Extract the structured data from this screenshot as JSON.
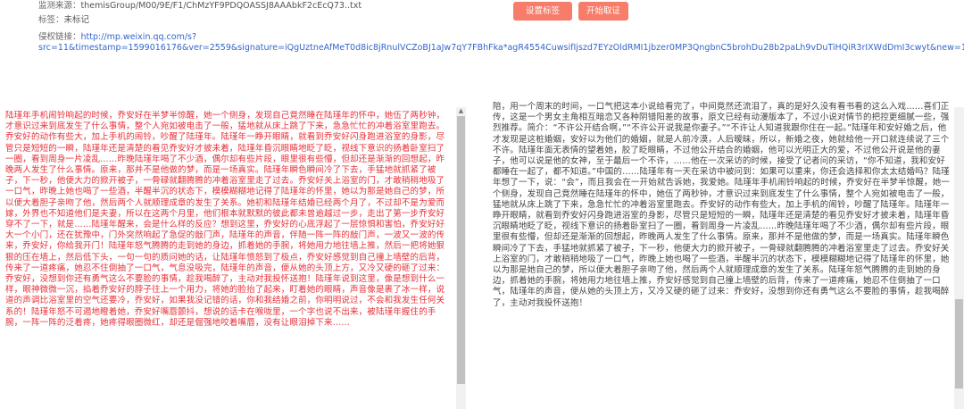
{
  "meta": {
    "path_label": "监测来源：",
    "path_value": "themisGroup/M00/9E/F1/ChMzYF9PDQOASSJ8AAAbkF2cEcQ73..txt",
    "tag_label": "标签：",
    "tag_value": "未标记",
    "link_label": "侵权链接：",
    "link_value": "http://mp.weixin.qq.com/s?src=11&timestamp=1599016176&ver=2559&signature=iQgUztneAfMeT0d8ic8jRnulVCZoBJ1aJw7qY7FBhFka*agR4554CuwsifIjszd7EYzOldRMI1jbzer0MP3QngbnC5brohDu28b2paLh9vDuTiHQiR3rIXWdDmI3cwyt&new=1"
  },
  "buttons": {
    "tag": "设置标签",
    "start": "开始取证"
  },
  "left_text": "陆瑾年手机闹铃响起的时候，乔安好在半梦半惊醒，她一个侧身，发现自己竟然睡在陆瑾年的怀中，她伍了两秒钟，才意识过来到底发生了什么事情，整个人宛如被电击了一般，猛地就从床上跳了下来，急急忙忙的冲着浴室里跑去。乔安好的动作有些大，加上手机的闹铃，吵醒了陆瑾年。陆瑾年一睁开眼睛，就看到乔安好闪身跑进浴室的身影，尽管只是短短的一瞬，陆瑾年还是清楚的看见乔安好才披未着，陆瑾年昏沉眼睛地眨了眨，视线下意识的扬着卧室扫了一圈，看到周身一片凌乱……昨晚陆瑾年喝了不少酒，偶尔却有些片段，眼里很有些懵，但却还是渐渐的回想起，昨晚两人发生了什么事情。原来，那并不是他做的梦，而是一场真实。陆瑾年瞬色瞬间冷了下去，手猛地就抓紧了被子，下一秒，他便大力的掀开被子，一骨碌就翻腾腾的冲着浴室里走了过去。乔安好关上浴室的门，才敢稍稍地吸了一口气，昨晚上她也喝了一些酒，半醒半沉的状态下，模模糊糊地记得了陆瑾年的怀里，她以为那是她自己的梦，所以便大着胆子亲吻了他，然后两个人就顺理成章的发生了关系。她初和陆瑾年结婚已经两个月了，不过却不是为爱而嫁，外界也不知道他们是夫妻，所以在这两个月里，他们根本就默默的彼此都未曾逾越过一步，走出了第一步乔安好穿不了一下，就是……陆瑾年醒来，会是什么样的反应？想到这里，乔安好的心底浮起了一层惊惧和害怕，乔安好好大一个小门，还在犹豫中，门外突然响起了急促的敲门声，陆瑾年的声音，伴随一阵一阵的敲门声，一波又一波的传来，乔安好，你给我开门！陆瑾年怒气腾腾的走到她的身边，抓着她的手腕，将她用力地往墙上推，然后一把将她狠狠的压在墙上，然后低下头，一句一句的质问她的话，让陆瑾年愤怒到了极点，乔安好感觉到自己撞上墙壁的后背，传来了一道疼痛，她忍不住倒抽了一口气，气息没吸完，陆瑾年的声音，便从她的头顶上方，又冷又硬的砸了过来：乔安好，没想到你还有勇气这么不要脸的事情，趁我喝醉了，主动对我投怀送抱！陆瑾年说到这里，像是想到什么一样，眼神微微一沉，掐着乔安好的脖子往上一个用力，将她的脸抬了起来，盯着她的眼睛，声音像是裹了冰一样，说道的声调比浴室里的空气还要冷，乔安好，如果我没记错的话，你和我结婚之前，你明明说过，不会和我发生任何关系的！陆瑾年怒不可遏地瞪着她，乔安好嘴唇颤抖，想说的话卡在喉咙里，一个字也说不出来，被陆瑾年握住的手腕，一阵一阵的泛着疼，她疼得眼圈微红，却还是倔强地咬着嘴唇，没有让眼泪掉下来……",
  "right_text": "陪，用一个周末的时间，一口气把这本小说给看完了，中间竟然还流泪了，真的是好久没有看书看的这么入戏……喜们正传，这是一个男女主角相互暗恋又各种阴错阳差的故事，原文已经有动漫版本了，不过小说对情节的把控更细腻一些，强烈推荐。简介：“不许公开结合啊，”“不许公开说我是你妻子。”“不许让人知道我跟你住在一起。”陆瑾年和安好婚之后，他才发现是这桩婚姻，安好以为他们的婚姻，就是人前冷漠，人后暧昧，所以，新婚之夜，她就给他一开口就连续说了三个不许。陆瑾年面无表情的望着她，胶了眨眼睛，不过他公开结合的婚姻，他可以光明正大的爱，不过他公开说是他的妻子，他可以说是他的女神，至于最后一个不许，……他在一次采访的时候，接受了记者问的采访，“你不知道，我和安好都睡在一起了，都不知道。”中国的……陆瑾年有一天在采访中被问到：如果可以重来，你还会选择和你太太结婚吗？陆瑾年想了一下，说：“会”，而且我会在一开始就告诉她，我爱她。陆瑾年手机闹铃响起的时候，乔安好在半梦半惊醒，她一个侧身，发现自己竟然睡在陆瑾年的怀中，她伍了两秒钟，才意识过来到底发生了什么事情，整个人宛如被电击了一般，猛地就从床上跳了下来，急急忙忙的冲着浴室里跑去。乔安好的动作有些大，加上手机的闹铃，吵醒了陆瑾年。陆瑾年一睁开眼睛，就看到乔安好闪身跑进浴室的身影，尽管只是短短的一瞬，陆瑾年还是清楚的看见乔安好才披未着，陆瑾年昏沉眼睛地眨了眨，视线下意识的扬着卧室扫了一圈，看到周身一片凌乱……昨晚陆瑾年喝了不少酒，偶尔却有些片段，眼里很有些懵，但却还是渐渐的回想起，昨晚两人发生了什么事情。原来，那并不是他做的梦，而是一场真实。陆瑾年瞬色瞬间冷了下去，手猛地就抓紧了被子，下一秒，他便大力的掀开被子，一骨碌就翻腾腾的冲着浴室里走了过去。乔安好关上浴室的门，才敢稍稍地吸了一口气，昨晚上她也喝了一些酒，半醒半沉的状态下，模模糊糊地记得了陆瑾年的怀里，她以为那是她自己的梦，所以便大着胆子亲吻了他，然后两个人就顺理成章的发生了关系。陆瑾年怒气腾腾的走到她的身边，抓着她的手腕，将她用力地往墙上推，乔安好感觉到自己撞上墙壁的后背，传来了一道疼痛，她忍不住倒抽了一口气，陆瑾年的声音，便从她的头顶上方，又冷又硬的砸了过来：乔安好，没想到你还有勇气这么不要脸的事情，趁我喝醉了，主动对我投怀送抱！"
}
